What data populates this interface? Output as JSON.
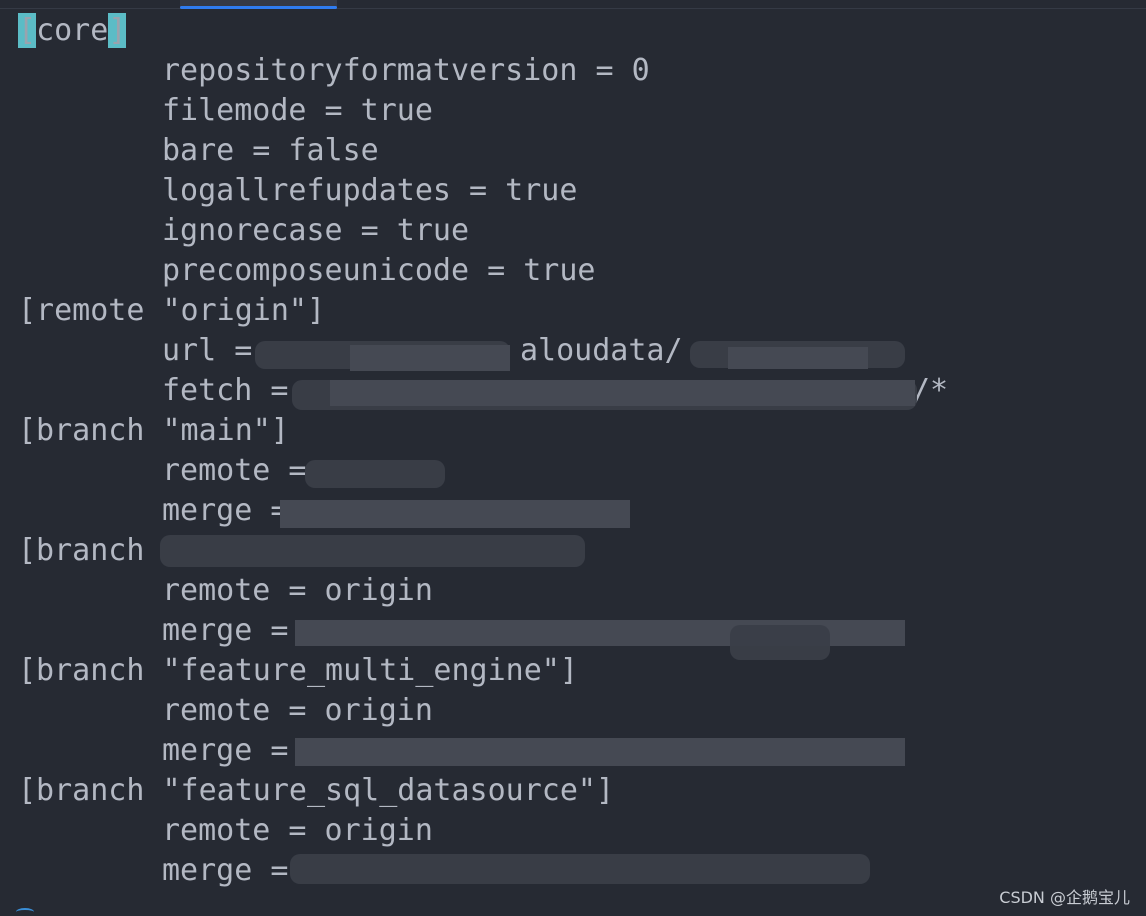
{
  "editor": {
    "lines": [
      {
        "indent": false,
        "text": "core",
        "prefix": "[",
        "suffix": "]",
        "highlight_brackets": true
      },
      {
        "indent": true,
        "text": "repositoryformatversion = 0"
      },
      {
        "indent": true,
        "text": "filemode = true"
      },
      {
        "indent": true,
        "text": "bare = false"
      },
      {
        "indent": true,
        "text": "logallrefupdates = true"
      },
      {
        "indent": true,
        "text": "ignorecase = true"
      },
      {
        "indent": true,
        "text": "precomposeunicode = true"
      },
      {
        "indent": false,
        "text": "[remote \"origin\"]"
      },
      {
        "indent": true,
        "text": "url = ",
        "visible_fragment": "aloudata/"
      },
      {
        "indent": true,
        "text": "fetch = ",
        "visible_fragment": "/*"
      },
      {
        "indent": false,
        "text": "[branch \"main\"]"
      },
      {
        "indent": true,
        "text": "remote = "
      },
      {
        "indent": true,
        "text": "merge = "
      },
      {
        "indent": false,
        "text": "[branch "
      },
      {
        "indent": true,
        "text": "remote = origin"
      },
      {
        "indent": true,
        "text": "merge = "
      },
      {
        "indent": false,
        "text": "[branch \"feature_multi_engine\"]"
      },
      {
        "indent": true,
        "text": "remote = origin"
      },
      {
        "indent": true,
        "text": "merge = "
      },
      {
        "indent": false,
        "text": "[branch \"feature_sql_datasource\"]"
      },
      {
        "indent": true,
        "text": "remote = origin"
      },
      {
        "indent": true,
        "text": "merge = "
      }
    ]
  },
  "watermark": "CSDN @企鹅宝儿",
  "colors": {
    "background": "#262a33",
    "text": "#b3b8c3",
    "bracket_highlight": "#5bbcc6",
    "tab_indicator": "#2f7cf0"
  }
}
